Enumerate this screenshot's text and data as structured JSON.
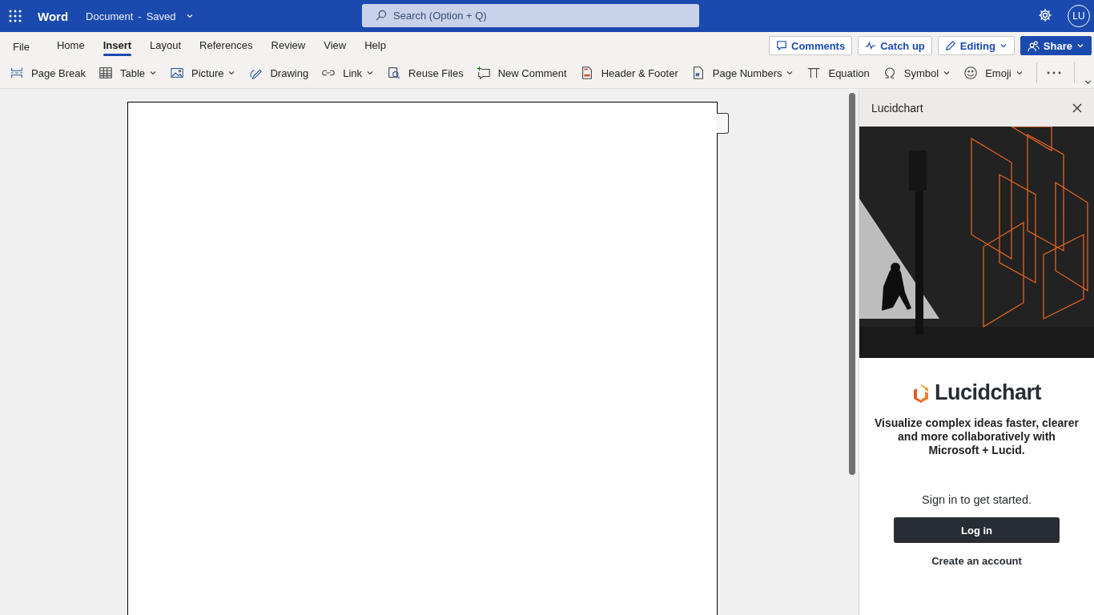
{
  "app": {
    "name": "Word",
    "document": "Document",
    "separator": "-",
    "status": "Saved",
    "search_placeholder": "Search (Option + Q)",
    "user_initials": "LU"
  },
  "menu_tabs": [
    {
      "label": "File",
      "selected": false
    },
    {
      "label": "Home",
      "selected": false
    },
    {
      "label": "Insert",
      "selected": true
    },
    {
      "label": "Layout",
      "selected": false
    },
    {
      "label": "References",
      "selected": false
    },
    {
      "label": "Review",
      "selected": false
    },
    {
      "label": "View",
      "selected": false
    },
    {
      "label": "Help",
      "selected": false
    }
  ],
  "header_buttons": [
    {
      "label": "Comments",
      "kind": "outline",
      "has_menu": false
    },
    {
      "label": "Catch up",
      "kind": "outline",
      "has_menu": false
    },
    {
      "label": "Editing",
      "kind": "outline",
      "has_menu": true
    },
    {
      "label": "Share",
      "kind": "primary",
      "has_menu": true
    }
  ],
  "ribbon": [
    {
      "label": "Page Break",
      "has_menu": false
    },
    {
      "label": "Table",
      "has_menu": true
    },
    {
      "label": "Picture",
      "has_menu": true
    },
    {
      "label": "Drawing",
      "has_menu": false
    },
    {
      "label": "Link",
      "has_menu": true
    },
    {
      "label": "Reuse Files",
      "has_menu": false
    },
    {
      "label": "New Comment",
      "has_menu": false
    },
    {
      "label": "Header & Footer",
      "has_menu": false
    },
    {
      "label": "Page Numbers",
      "has_menu": true
    },
    {
      "label": "Equation",
      "has_menu": false
    },
    {
      "label": "Symbol",
      "has_menu": true
    },
    {
      "label": "Emoji",
      "has_menu": true
    }
  ],
  "panel": {
    "title": "Lucidchart",
    "logo_text": "Lucidchart",
    "tagline": "Visualize complex ideas faster, clearer and more collaboratively with Microsoft + Lucid.",
    "prompt": "Sign in to get started.",
    "login_button": "Log in",
    "create_account": "Create an account"
  }
}
